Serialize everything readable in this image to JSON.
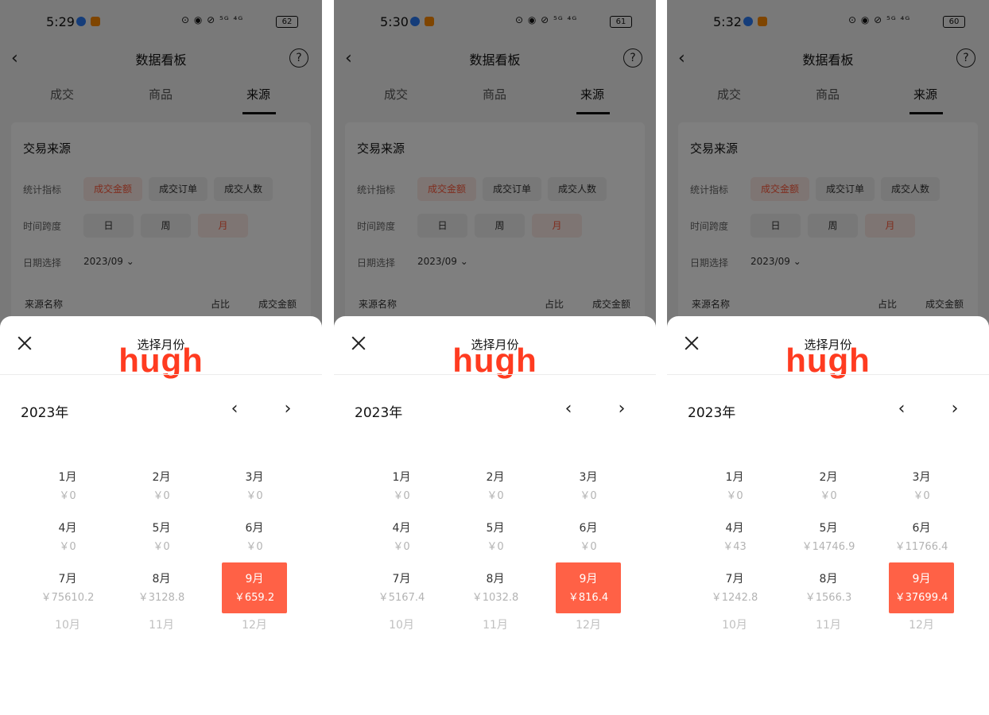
{
  "colors": {
    "accent": "#ff6146",
    "watermark": "#ff3b20"
  },
  "screens": [
    {
      "status": {
        "time": "5:29",
        "battery": "62",
        "signal_icons": "⊙ ◉ ⊘ ⁵ᴳ ⁴ᴳ"
      },
      "header": {
        "title": "数据看板",
        "back_icon": "chevron-left",
        "help_icon": "question-circle"
      },
      "tabs": [
        "成交",
        "商品",
        "来源"
      ],
      "card": {
        "title": "交易来源",
        "metric_label": "统计指标",
        "metrics": [
          "成交金额",
          "成交订单",
          "成交人数"
        ],
        "span_label": "时间跨度",
        "spans": [
          "日",
          "周",
          "月"
        ],
        "date_label": "日期选择",
        "date_value": "2023/09",
        "columns": [
          "来源名称",
          "占比",
          "成交金额"
        ]
      },
      "sheet": {
        "title": "选择月份",
        "watermark": "hugh",
        "year": "2023年",
        "months": [
          {
            "name": "1月",
            "value": "￥0"
          },
          {
            "name": "2月",
            "value": "￥0"
          },
          {
            "name": "3月",
            "value": "￥0"
          },
          {
            "name": "4月",
            "value": "￥0"
          },
          {
            "name": "5月",
            "value": "￥0"
          },
          {
            "name": "6月",
            "value": "￥0"
          },
          {
            "name": "7月",
            "value": "￥75610.2"
          },
          {
            "name": "8月",
            "value": "￥3128.8"
          },
          {
            "name": "9月",
            "value": "￥659.2",
            "selected": true
          },
          {
            "name": "10月",
            "value": ""
          },
          {
            "name": "11月",
            "value": ""
          },
          {
            "name": "12月",
            "value": ""
          }
        ]
      }
    },
    {
      "status": {
        "time": "5:30",
        "battery": "61",
        "signal_icons": "⊙ ◉ ⊘ ⁵ᴳ ⁴ᴳ"
      },
      "header": {
        "title": "数据看板",
        "back_icon": "chevron-left",
        "help_icon": "question-circle"
      },
      "tabs": [
        "成交",
        "商品",
        "来源"
      ],
      "card": {
        "title": "交易来源",
        "metric_label": "统计指标",
        "metrics": [
          "成交金额",
          "成交订单",
          "成交人数"
        ],
        "span_label": "时间跨度",
        "spans": [
          "日",
          "周",
          "月"
        ],
        "date_label": "日期选择",
        "date_value": "2023/09",
        "columns": [
          "来源名称",
          "占比",
          "成交金额"
        ]
      },
      "sheet": {
        "title": "选择月份",
        "watermark": "hugh",
        "year": "2023年",
        "months": [
          {
            "name": "1月",
            "value": "￥0"
          },
          {
            "name": "2月",
            "value": "￥0"
          },
          {
            "name": "3月",
            "value": "￥0"
          },
          {
            "name": "4月",
            "value": "￥0"
          },
          {
            "name": "5月",
            "value": "￥0"
          },
          {
            "name": "6月",
            "value": "￥0"
          },
          {
            "name": "7月",
            "value": "￥5167.4"
          },
          {
            "name": "8月",
            "value": "￥1032.8"
          },
          {
            "name": "9月",
            "value": "￥816.4",
            "selected": true
          },
          {
            "name": "10月",
            "value": ""
          },
          {
            "name": "11月",
            "value": ""
          },
          {
            "name": "12月",
            "value": ""
          }
        ]
      }
    },
    {
      "status": {
        "time": "5:32",
        "battery": "60",
        "signal_icons": "⊙ ◉ ⊘ ⁵ᴳ ⁴ᴳ"
      },
      "header": {
        "title": "数据看板",
        "back_icon": "chevron-left",
        "help_icon": "question-circle"
      },
      "tabs": [
        "成交",
        "商品",
        "来源"
      ],
      "card": {
        "title": "交易来源",
        "metric_label": "统计指标",
        "metrics": [
          "成交金额",
          "成交订单",
          "成交人数"
        ],
        "span_label": "时间跨度",
        "spans": [
          "日",
          "周",
          "月"
        ],
        "date_label": "日期选择",
        "date_value": "2023/09",
        "columns": [
          "来源名称",
          "占比",
          "成交金额"
        ]
      },
      "sheet": {
        "title": "选择月份",
        "watermark": "hugh",
        "year": "2023年",
        "months": [
          {
            "name": "1月",
            "value": "￥0"
          },
          {
            "name": "2月",
            "value": "￥0"
          },
          {
            "name": "3月",
            "value": "￥0"
          },
          {
            "name": "4月",
            "value": "￥43"
          },
          {
            "name": "5月",
            "value": "￥14746.9"
          },
          {
            "name": "6月",
            "value": "￥11766.4"
          },
          {
            "name": "7月",
            "value": "￥1242.8"
          },
          {
            "name": "8月",
            "value": "￥1566.3"
          },
          {
            "name": "9月",
            "value": "￥37699.4",
            "selected": true
          },
          {
            "name": "10月",
            "value": ""
          },
          {
            "name": "11月",
            "value": ""
          },
          {
            "name": "12月",
            "value": ""
          }
        ]
      }
    }
  ]
}
